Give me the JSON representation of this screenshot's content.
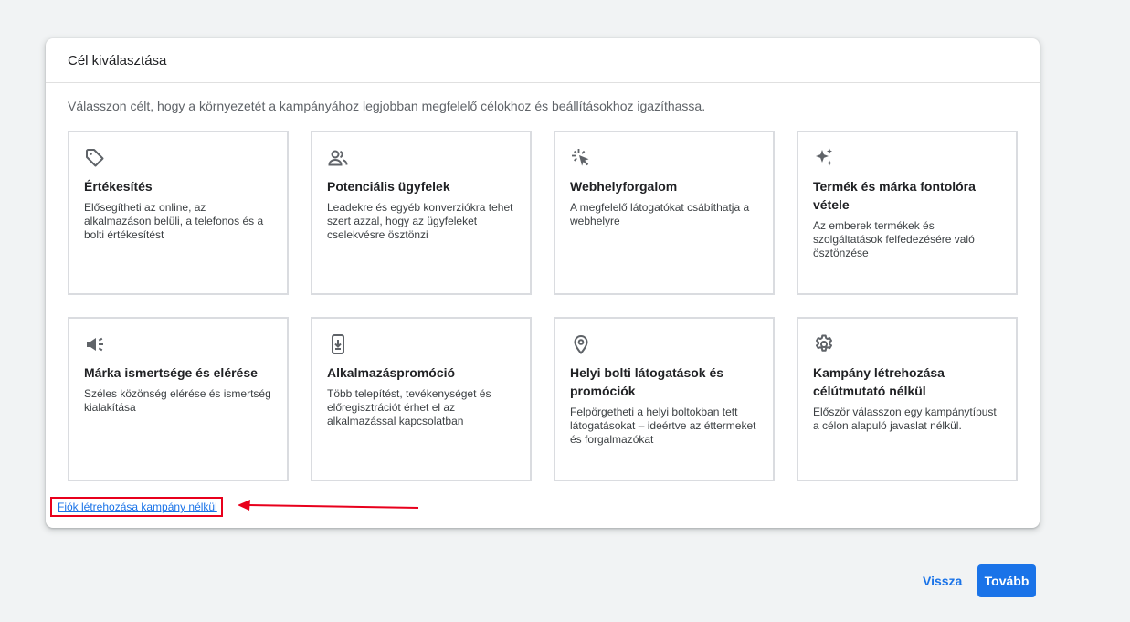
{
  "dialog": {
    "title": "Cél kiválasztása",
    "intro": "Válasszon célt, hogy a környezetét a kampányához legjobban megfelelő célokhoz és beállításokhoz igazíthassa."
  },
  "cards": [
    {
      "icon": "tag-icon",
      "title": "Értékesítés",
      "desc": "Elősegítheti az online, az alkalmazáson belüli, a telefonos és a bolti értékesítést"
    },
    {
      "icon": "people-icon",
      "title": "Potenciális ügyfelek",
      "desc": "Leadekre és egyéb konverziókra tehet szert azzal, hogy az ügyfeleket cselekvésre ösztönzi"
    },
    {
      "icon": "cursor-click-icon",
      "title": "Webhelyforgalom",
      "desc": "A megfelelő látogatókat csábíthatja a webhelyre"
    },
    {
      "icon": "sparkle-icon",
      "title": "Termék és márka fontolóra vétele",
      "desc": "Az emberek termékek és szolgáltatások felfedezésére való ösztönzése"
    },
    {
      "icon": "megaphone-icon",
      "title": "Márka ismertsége és elérése",
      "desc": "Széles közönség elérése és ismertség kialakítása"
    },
    {
      "icon": "phone-download-icon",
      "title": "Alkalmazáspromóció",
      "desc": "Több telepítést, tevékenységet és előregisztrációt érhet el az alkalmazással kapcsolatban"
    },
    {
      "icon": "location-pin-icon",
      "title": "Helyi bolti látogatások és promóciók",
      "desc": "Felpörgetheti a helyi boltokban tett látogatásokat – ideértve az éttermeket és forgalmazókat"
    },
    {
      "icon": "gear-icon",
      "title": "Kampány létrehozása célútmutató nélkül",
      "desc": "Először válasszon egy kampánytípust a célon alapuló javaslat nélkül."
    }
  ],
  "link": {
    "label": "Fiók létrehozása kampány nélkül"
  },
  "actions": {
    "back_label": "Vissza",
    "next_label": "Tovább"
  },
  "colors": {
    "accent": "#1a73e8",
    "highlight": "#e8001c",
    "background": "#f1f3f4"
  }
}
